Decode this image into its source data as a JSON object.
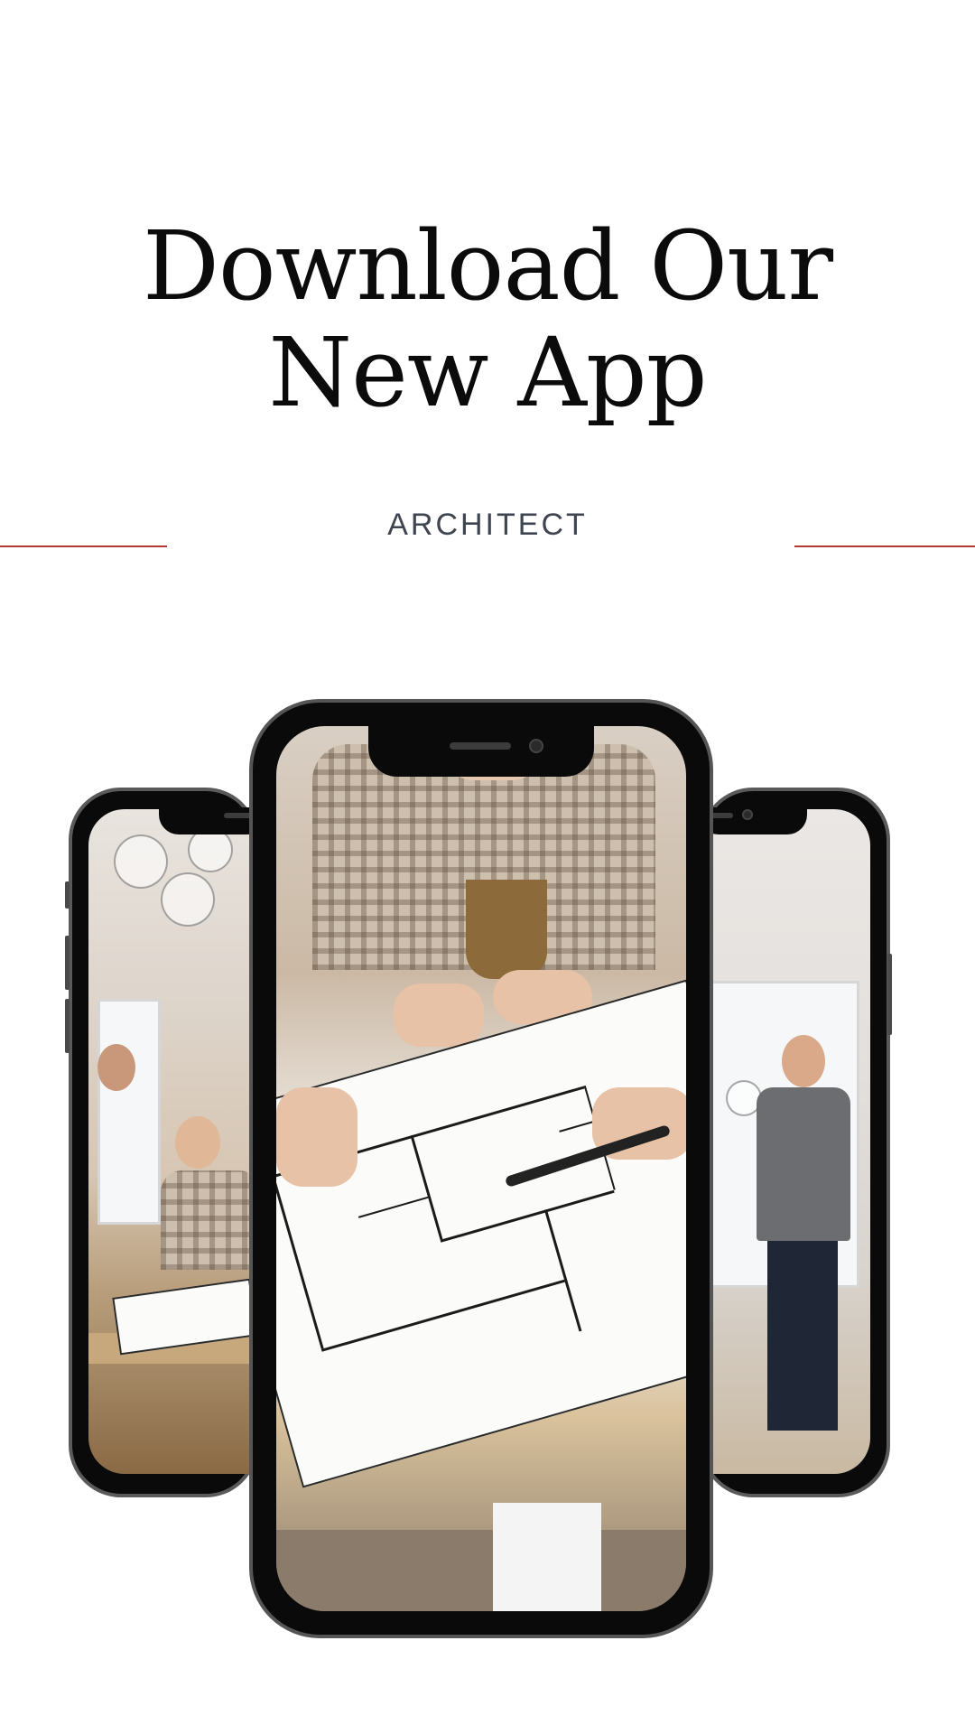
{
  "headline": {
    "line1": "Download Our",
    "line2": "New App"
  },
  "subtitle": "ARCHITECT",
  "colors": {
    "accent_rule": "#b23a33",
    "headline": "#0b0b0b",
    "subtitle": "#3e4450",
    "background": "#ffffff"
  }
}
